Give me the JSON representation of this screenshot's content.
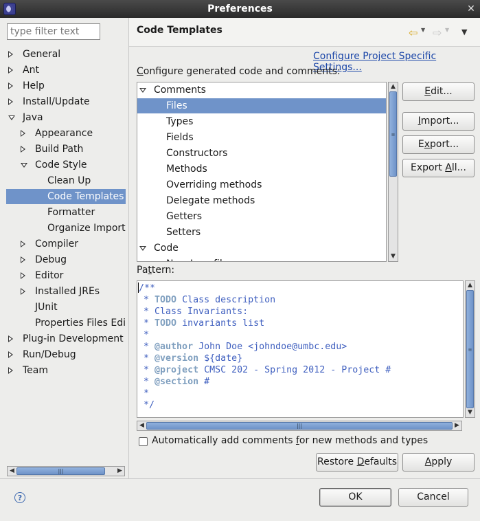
{
  "window": {
    "title": "Preferences"
  },
  "filter": {
    "placeholder": "type filter text"
  },
  "nav_tree": [
    {
      "label": "General",
      "state": "collapsed",
      "depth": 0
    },
    {
      "label": "Ant",
      "state": "collapsed",
      "depth": 0
    },
    {
      "label": "Help",
      "state": "collapsed",
      "depth": 0
    },
    {
      "label": "Install/Update",
      "state": "collapsed",
      "depth": 0
    },
    {
      "label": "Java",
      "state": "expanded",
      "depth": 0
    },
    {
      "label": "Appearance",
      "state": "collapsed",
      "depth": 1
    },
    {
      "label": "Build Path",
      "state": "collapsed",
      "depth": 1
    },
    {
      "label": "Code Style",
      "state": "expanded",
      "depth": 1
    },
    {
      "label": "Clean Up",
      "state": "leaf",
      "depth": 2
    },
    {
      "label": "Code Templates",
      "state": "leaf",
      "depth": 2,
      "selected": true
    },
    {
      "label": "Formatter",
      "state": "leaf",
      "depth": 2
    },
    {
      "label": "Organize Imports",
      "state": "leaf",
      "depth": 2
    },
    {
      "label": "Compiler",
      "state": "collapsed",
      "depth": 1
    },
    {
      "label": "Debug",
      "state": "collapsed",
      "depth": 1
    },
    {
      "label": "Editor",
      "state": "collapsed",
      "depth": 1
    },
    {
      "label": "Installed JREs",
      "state": "collapsed",
      "depth": 1
    },
    {
      "label": "JUnit",
      "state": "leaf",
      "depth": 1
    },
    {
      "label": "Properties Files Edit",
      "state": "leaf",
      "depth": 1
    },
    {
      "label": "Plug-in Development",
      "state": "collapsed",
      "depth": 0
    },
    {
      "label": "Run/Debug",
      "state": "collapsed",
      "depth": 0
    },
    {
      "label": "Team",
      "state": "collapsed",
      "depth": 0
    }
  ],
  "page": {
    "title": "Code Templates",
    "configure_link": "Configure Project Specific Settings...",
    "configure_label_prefix": "",
    "configure_label_mn": "C",
    "configure_label_rest": "onfigure generated code and comments:",
    "pattern_label_prefix": "Pa",
    "pattern_label_mn": "t",
    "pattern_label_rest": "tern:"
  },
  "templates_tree": [
    {
      "label": "Comments",
      "state": "expanded",
      "depth": 0
    },
    {
      "label": "Files",
      "state": "leaf",
      "depth": 1,
      "selected": true
    },
    {
      "label": "Types",
      "state": "leaf",
      "depth": 1
    },
    {
      "label": "Fields",
      "state": "leaf",
      "depth": 1
    },
    {
      "label": "Constructors",
      "state": "leaf",
      "depth": 1
    },
    {
      "label": "Methods",
      "state": "leaf",
      "depth": 1
    },
    {
      "label": "Overriding methods",
      "state": "leaf",
      "depth": 1
    },
    {
      "label": "Delegate methods",
      "state": "leaf",
      "depth": 1
    },
    {
      "label": "Getters",
      "state": "leaf",
      "depth": 1
    },
    {
      "label": "Setters",
      "state": "leaf",
      "depth": 1
    },
    {
      "label": "Code",
      "state": "expanded",
      "depth": 0
    },
    {
      "label": "New Java files",
      "state": "leaf",
      "depth": 1
    }
  ],
  "side_buttons": {
    "edit_pre": "",
    "edit_mn": "E",
    "edit_post": "dit...",
    "import_pre": "",
    "import_mn": "I",
    "import_post": "mport...",
    "export_pre": "E",
    "export_mn": "x",
    "export_post": "port...",
    "exportall_pre": "Export ",
    "exportall_mn": "A",
    "exportall_post": "ll..."
  },
  "pattern": {
    "lines": [
      [
        {
          "t": "/**",
          "c": ""
        }
      ],
      [
        {
          "t": " * ",
          "c": ""
        },
        {
          "t": "TODO",
          "c": "todo"
        },
        {
          "t": " Class description",
          "c": ""
        }
      ],
      [
        {
          "t": " * Class Invariants:",
          "c": ""
        }
      ],
      [
        {
          "t": " * ",
          "c": ""
        },
        {
          "t": "TODO",
          "c": "todo"
        },
        {
          "t": " invariants list",
          "c": ""
        }
      ],
      [
        {
          "t": " *",
          "c": ""
        }
      ],
      [
        {
          "t": " * ",
          "c": ""
        },
        {
          "t": "@author",
          "c": "tag"
        },
        {
          "t": " John Doe <johndoe@umbc.edu>",
          "c": ""
        }
      ],
      [
        {
          "t": " * ",
          "c": ""
        },
        {
          "t": "@version",
          "c": "tag"
        },
        {
          "t": " ${date}",
          "c": ""
        }
      ],
      [
        {
          "t": " * ",
          "c": ""
        },
        {
          "t": "@project",
          "c": "tag"
        },
        {
          "t": " CMSC 202 - Spring 2012 - Project #",
          "c": ""
        }
      ],
      [
        {
          "t": " * ",
          "c": ""
        },
        {
          "t": "@section",
          "c": "tag"
        },
        {
          "t": " #",
          "c": ""
        }
      ],
      [
        {
          "t": " *",
          "c": ""
        }
      ],
      [
        {
          "t": " */",
          "c": ""
        }
      ]
    ]
  },
  "auto_comments": {
    "pre": "Automatically add comments ",
    "mn": "f",
    "post": "or new methods and types",
    "checked": false
  },
  "footer_buttons": {
    "restore_pre": "Restore ",
    "restore_mn": "D",
    "restore_post": "efaults",
    "apply_pre": "",
    "apply_mn": "A",
    "apply_post": "pply",
    "ok": "OK",
    "cancel": "Cancel"
  },
  "icons": {
    "app": "eclipse-icon",
    "close": "close-icon",
    "back": "back-arrow-icon",
    "forward": "forward-arrow-icon",
    "menu": "view-menu-icon",
    "help": "help-icon"
  },
  "colors": {
    "selection": "#6f93c9",
    "link": "#1b46a8",
    "javadoc": "#3f5fbf",
    "javadoc_tag": "#7f9fbf"
  }
}
